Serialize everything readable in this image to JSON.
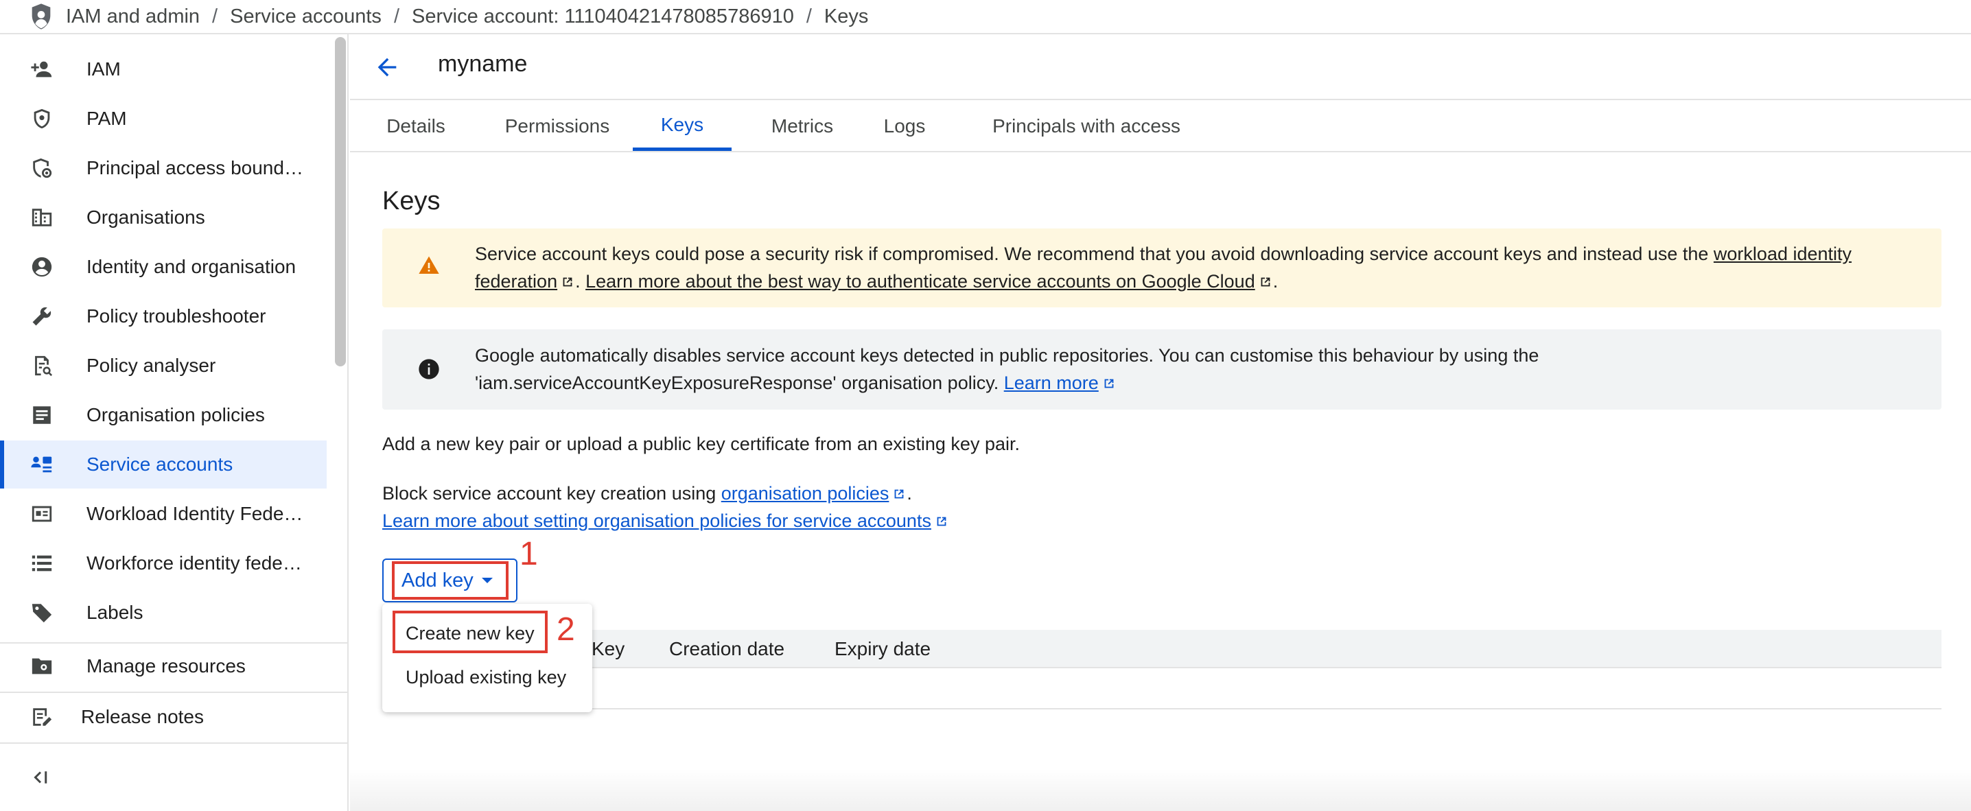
{
  "breadcrumb": {
    "items": [
      "IAM and admin",
      "Service accounts",
      "Service account: 111040421478085786910",
      "Keys"
    ],
    "separator": "/"
  },
  "sidebar": {
    "items": [
      {
        "label": "IAM",
        "icon": "person-add-icon"
      },
      {
        "label": "PAM",
        "icon": "shield-lock-icon"
      },
      {
        "label": "Principal access bound…",
        "icon": "shield-settings-icon"
      },
      {
        "label": "Organisations",
        "icon": "building-icon"
      },
      {
        "label": "Identity and organisation",
        "icon": "account-circle-icon"
      },
      {
        "label": "Policy troubleshooter",
        "icon": "wrench-icon"
      },
      {
        "label": "Policy analyser",
        "icon": "document-search-icon"
      },
      {
        "label": "Organisation policies",
        "icon": "article-icon"
      },
      {
        "label": "Service accounts",
        "icon": "service-account-icon",
        "active": true
      },
      {
        "label": "Workload Identity Fede…",
        "icon": "id-card-icon"
      },
      {
        "label": "Workforce identity fede…",
        "icon": "list-icon"
      },
      {
        "label": "Labels",
        "icon": "tag-icon"
      }
    ],
    "manage_resources": "Manage resources",
    "release_notes": "Release notes"
  },
  "header": {
    "title": "myname"
  },
  "tabs": [
    "Details",
    "Permissions",
    "Keys",
    "Metrics",
    "Logs",
    "Principals with access"
  ],
  "active_tab": "Keys",
  "section_title": "Keys",
  "warning": {
    "text1": "Service account keys could pose a security risk if compromised. We recommend that you avoid downloading service account keys and instead use the ",
    "link1_a": "workload identity",
    "link1_b": "federation",
    "text2": ". ",
    "link2": "Learn more about the best way to authenticate service accounts on Google Cloud",
    "text3": "."
  },
  "info": {
    "line1": "Google automatically disables service account keys detected in public repositories. You can customise this behaviour by using the",
    "line2": "'iam.serviceAccountKeyExposureResponse' organisation policy. ",
    "link": "Learn more"
  },
  "add_text": "Add a new key pair or upload a public key certificate from an existing key pair.",
  "block": {
    "text": "Block service account key creation using ",
    "link": "organisation policies",
    "end": ".",
    "learn_more": "Learn more about setting organisation policies for service accounts"
  },
  "add_key_button": "Add key",
  "dropdown": {
    "items": [
      "Create new key",
      "Upload existing key"
    ]
  },
  "table": {
    "columns": [
      "Key",
      "Creation date",
      "Expiry date"
    ]
  },
  "annotations": {
    "step1": "1",
    "step2": "2",
    "color": "#e03c31"
  },
  "colors": {
    "accent": "#0b57d0",
    "warning_bg": "#fef7e0",
    "warning_icon": "#e37400",
    "info_bg": "#f1f3f4"
  }
}
